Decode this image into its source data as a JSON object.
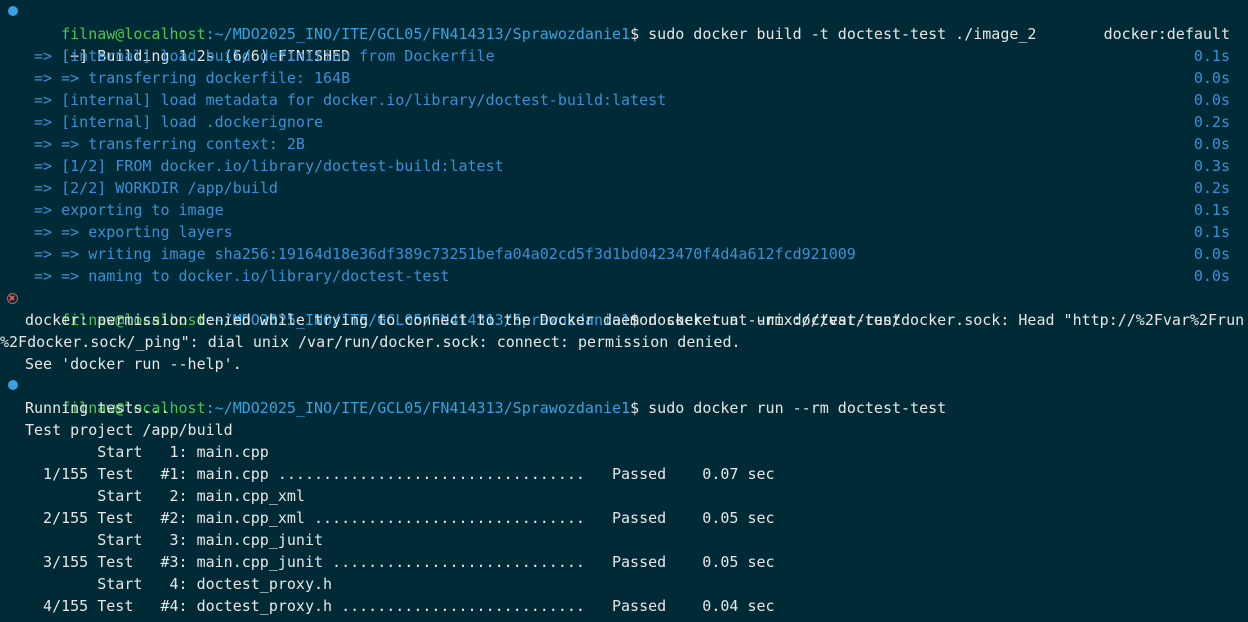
{
  "prompt": {
    "user": "filnaw@localhost",
    "path": ":~/MDO2025_INO/ITE/GCL05/FN414313/Sprawozdanie1",
    "symbol": "$"
  },
  "lines": {
    "cmd1": " sudo docker build -t doctest-test ./image_2",
    "building": "[+] Building 1.2s (6/6) FINISHED",
    "builder": "docker:default",
    "steps": [
      {
        "text": " => [internal] load build definition from Dockerfile",
        "time": "0.1s"
      },
      {
        "text": " => => transferring dockerfile: 164B",
        "time": "0.0s"
      },
      {
        "text": " => [internal] load metadata for docker.io/library/doctest-build:latest",
        "time": "0.0s"
      },
      {
        "text": " => [internal] load .dockerignore",
        "time": "0.2s"
      },
      {
        "text": " => => transferring context: 2B",
        "time": "0.0s"
      },
      {
        "text": " => [1/2] FROM docker.io/library/doctest-build:latest",
        "time": "0.3s"
      },
      {
        "text": " => [2/2] WORKDIR /app/build",
        "time": "0.2s"
      },
      {
        "text": " => exporting to image",
        "time": "0.1s"
      },
      {
        "text": " => => exporting layers",
        "time": "0.1s"
      },
      {
        "text": " => => writing image sha256:19164d18e36df389c73251befa04a02cd5f3d1bd0423470f4d4a612fcd921009",
        "time": "0.0s"
      },
      {
        "text": " => => naming to docker.io/library/doctest-test",
        "time": "0.0s"
      }
    ],
    "cmd2": " docker run --rm doctest-test",
    "err1": "docker: permission denied while trying to connect to the Docker daemon socket at unix:///var/run/docker.sock: Head \"http://%2Fvar%2Frun",
    "err2": "%2Fdocker.sock/_ping\": dial unix /var/run/docker.sock: connect: permission denied.",
    "err3": "See 'docker run --help'.",
    "cmd3": " sudo docker run --rm doctest-test",
    "running": "Running tests...",
    "project": "Test project /app/build",
    "tests": [
      "        Start   1: main.cpp",
      "  1/155 Test   #1: main.cpp ..................................   Passed    0.07 sec",
      "        Start   2: main.cpp_xml",
      "  2/155 Test   #2: main.cpp_xml ..............................   Passed    0.05 sec",
      "        Start   3: main.cpp_junit",
      "  3/155 Test   #3: main.cpp_junit ............................   Passed    0.05 sec",
      "        Start   4: doctest_proxy.h",
      "  4/155 Test   #4: doctest_proxy.h ...........................   Passed    0.04 sec"
    ]
  }
}
